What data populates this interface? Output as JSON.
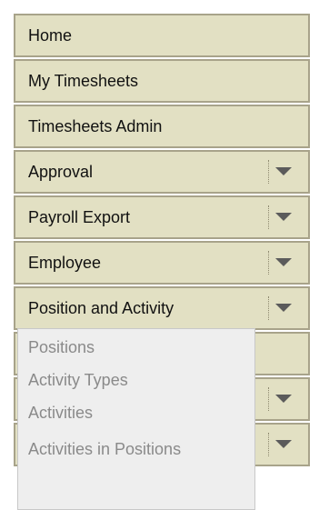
{
  "menu": {
    "items": [
      {
        "label": "Home",
        "has_dropdown": false
      },
      {
        "label": "My Timesheets",
        "has_dropdown": false
      },
      {
        "label": "Timesheets Admin",
        "has_dropdown": false
      },
      {
        "label": "Approval",
        "has_dropdown": true
      },
      {
        "label": "Payroll Export",
        "has_dropdown": true
      },
      {
        "label": "Employee",
        "has_dropdown": true
      },
      {
        "label": "Position and Activity",
        "has_dropdown": true
      },
      {
        "label": "",
        "has_dropdown": false
      },
      {
        "label": "",
        "has_dropdown": true
      },
      {
        "label": "",
        "has_dropdown": true
      }
    ],
    "dropdown_icon": "chevron-down-icon"
  },
  "submenu": {
    "options": [
      "Positions",
      "Activity Types",
      "Activities",
      "Activities in Positions"
    ]
  },
  "colors": {
    "item_bg": "#e2e0c3",
    "item_border": "#a8a38a",
    "submenu_bg": "#eeeeee",
    "submenu_text": "#8a8a8a"
  }
}
